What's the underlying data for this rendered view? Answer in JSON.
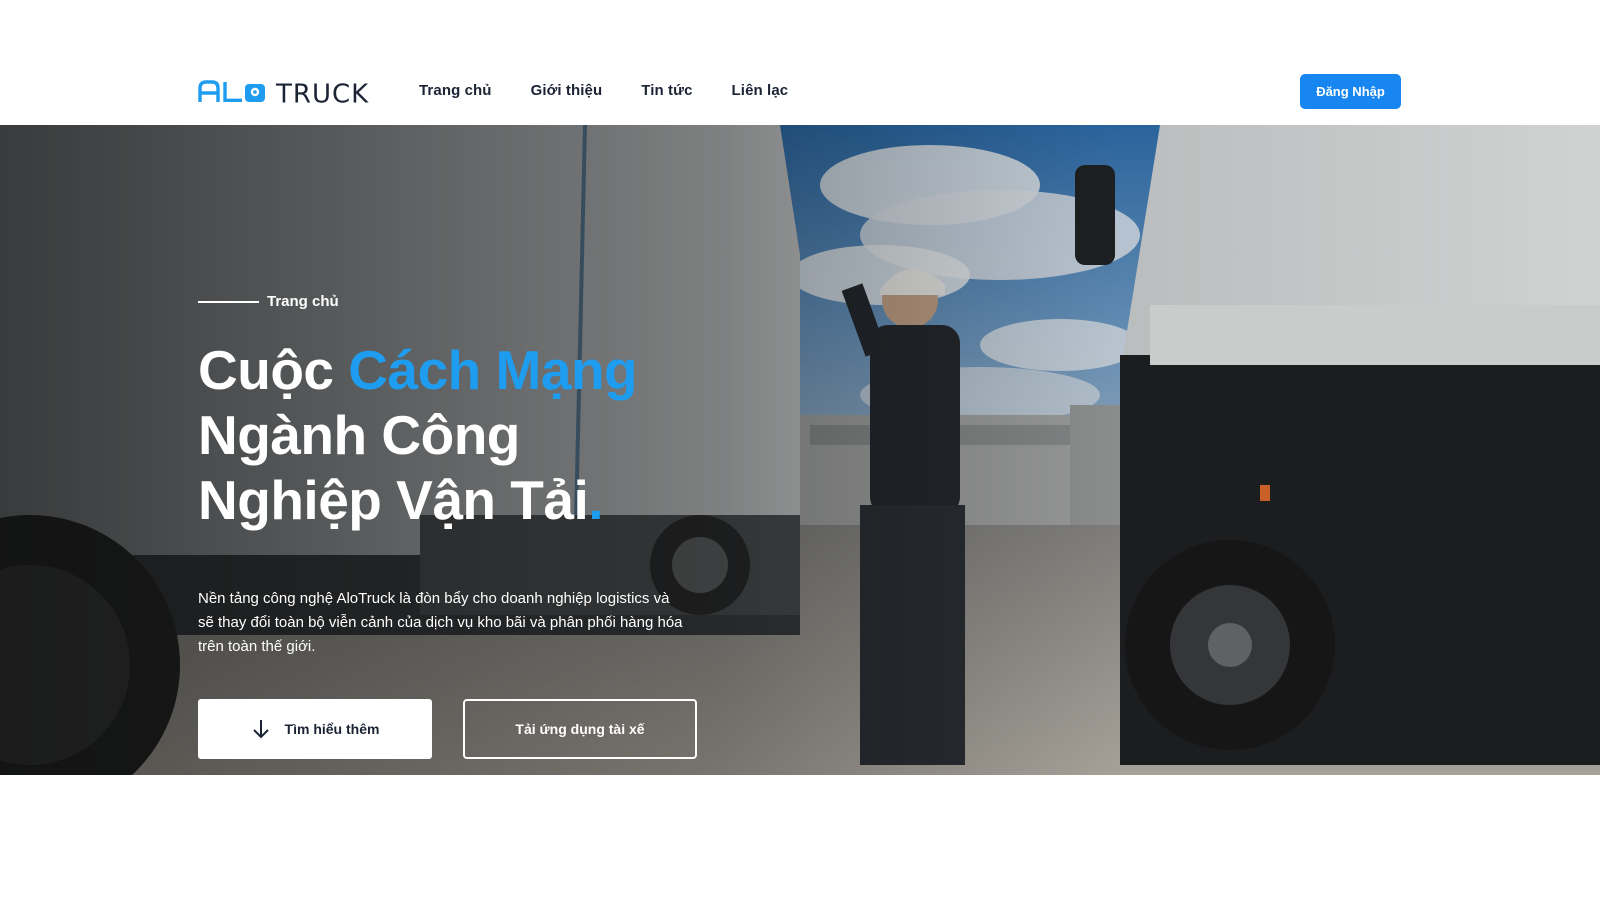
{
  "brand": {
    "logo_text_left": "ALO",
    "logo_text_right": "TRUCK",
    "colors": {
      "brand_blue": "#1e9df0",
      "dark_navy": "#1b2335",
      "button_blue": "#1786f0"
    }
  },
  "nav": {
    "items": [
      {
        "label": "Trang chủ"
      },
      {
        "label": "Giới thiệu"
      },
      {
        "label": "Tin tức"
      },
      {
        "label": "Liên lạc"
      }
    ],
    "login_label": "Đăng Nhập"
  },
  "hero": {
    "breadcrumb": "Trang chủ",
    "headline": {
      "part1": "Cuộc ",
      "accent": "Cách Mạng",
      "line2": "Ngành Công",
      "line3": "Nghiệp Vận Tải",
      "dot": "."
    },
    "description": "Nền tảng công nghệ AloTruck là đòn bẩy cho doanh nghiệp logistics và sẽ thay đổi toàn bộ viễn cảnh của dịch vụ kho bãi và phân phối hàng hóa trên toàn thế giới.",
    "primary_button": {
      "label": "Tìm hiểu thêm",
      "icon": "arrow-down-icon"
    },
    "secondary_button": {
      "label": "Tải ứng dụng tài xế"
    }
  }
}
